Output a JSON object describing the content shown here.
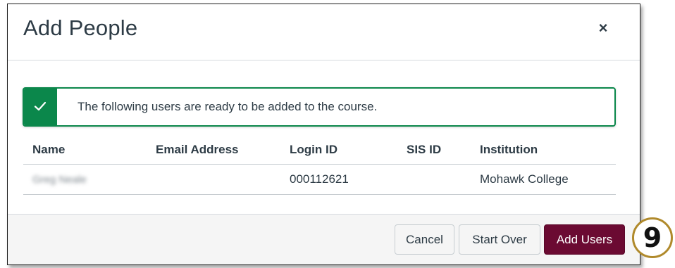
{
  "dialog": {
    "title": "Add People",
    "close_symbol": "×"
  },
  "alert": {
    "icon": "checkmark-icon",
    "message": "The following users are ready to be added to the course.",
    "accent_color": "#0b874b"
  },
  "table": {
    "headers": [
      "Name",
      "Email Address",
      "Login ID",
      "SIS ID",
      "Institution"
    ],
    "rows": [
      {
        "name": "Greg Neale",
        "email": "",
        "login_id": "000112621",
        "sis_id": "",
        "institution": "Mohawk College"
      }
    ]
  },
  "footer": {
    "cancel_label": "Cancel",
    "start_over_label": "Start Over",
    "add_users_label": "Add Users",
    "primary_color": "#6b0a32"
  },
  "step_badge": {
    "number": "9",
    "ring_color": "#b08a2c"
  }
}
